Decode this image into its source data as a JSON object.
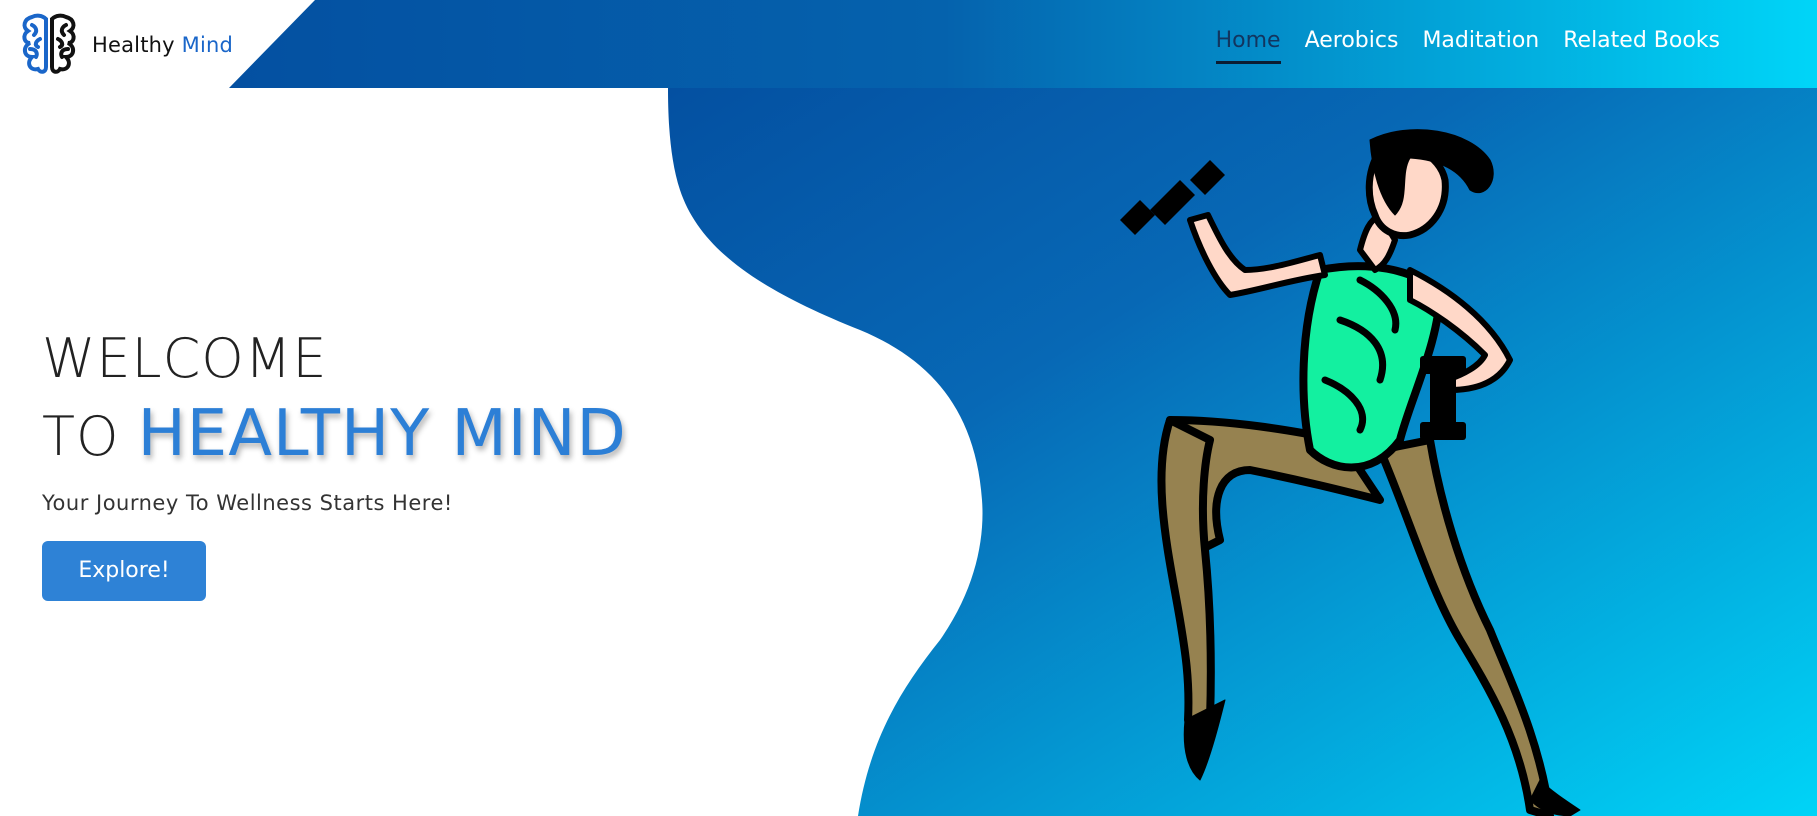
{
  "brand": {
    "name_part1": "Healthy ",
    "name_part2": "Mind",
    "logo_icon": "brain-icon"
  },
  "nav": {
    "items": [
      {
        "label": "Home",
        "active": true
      },
      {
        "label": "Aerobics",
        "active": false
      },
      {
        "label": "Maditation",
        "active": false
      },
      {
        "label": "Related Books",
        "active": false
      }
    ]
  },
  "hero": {
    "line1": "WELCOME",
    "line2_prefix": "TO ",
    "line2_highlight": "HEALTHY MIND",
    "tagline": "Your Journey To Wellness Starts Here!",
    "cta_label": "Explore!"
  },
  "illustration": {
    "icon": "woman-exercising-with-dumbbells"
  },
  "colors": {
    "accent": "#2e82d6",
    "gradient_dark": "#0450a1",
    "gradient_light": "#00d4f7"
  }
}
